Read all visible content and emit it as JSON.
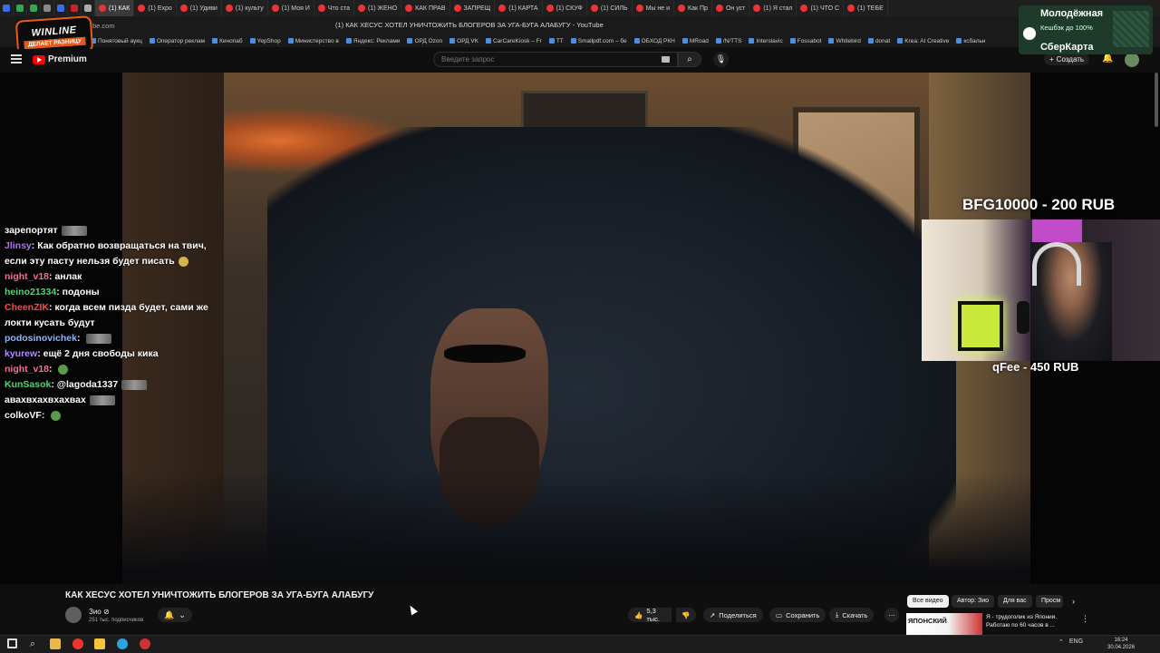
{
  "browser": {
    "tabs": [
      "(1) КАК",
      "(1) Expo",
      "(1) Удиви",
      "(1) культу",
      "(1) Моя И",
      "Что ста",
      "(1) ЖЕНО",
      "КАК ПРАВ",
      "ЗАПРЕЩ",
      "(1) КАРТА",
      "(1) СКУФ",
      "(1) СИЛЬ",
      "Мы не и",
      "Как Пр",
      "Он уст",
      "(1) Я стал",
      "(1) ЧТО С",
      "(1) ТЕБЕ"
    ],
    "url": "be.com",
    "page_title": "(1) КАК ХЕСУС ХОТЕЛ УНИЧТОЖИТЬ БЛОГЕРОВ ЗА УГА-БУГА АЛАБУГУ - YouTube",
    "bookmarks": [
      "Понятовый аукц",
      "Оператор реклам",
      "Кинопаб",
      "YepShop",
      "Министерство в",
      "Яндекс: Реклами",
      "ОРД Ozon",
      "ОРД VK",
      "CarCareKiosk – Fr",
      "TT",
      "Smallpdf.com – бе",
      "ОБХОД РКН",
      "MRoad",
      "/N/TTS",
      "Interslavic",
      "Fossabot",
      "Whitebird",
      "donat",
      "Krea: AI Creative",
      "ксбальн"
    ]
  },
  "overlay_ad": {
    "winline_title": "WINLINE",
    "winline_sub": "ДЕЛАЕТ РАЗНИЦУ",
    "bank_line1": "Молодёжная",
    "bank_line2": "Кешбэк до 100%",
    "bank_line3": "СберКарта"
  },
  "youtube": {
    "logo": "Premium",
    "search_placeholder": "Введите запрос",
    "create_label": "Создать"
  },
  "stream": {
    "chat": [
      {
        "name": "",
        "color": "#ffffff",
        "text": "зарепортят",
        "emote": "wide"
      },
      {
        "name": "Jlinsy",
        "color": "#b070ff",
        "text": "Как обратно возвращаться на твич, если эту пасту нельзя будет писать",
        "emote": "smile"
      },
      {
        "name": "night_v18",
        "color": "#ff6b9a",
        "text": "анлак",
        "emote": ""
      },
      {
        "name": "heino21334",
        "color": "#57d27a",
        "text": "подоны",
        "emote": ""
      },
      {
        "name": "CheenZIK",
        "color": "#ff4a4a",
        "text": "когда всем пизда будет, сами же локти кусать будут",
        "emote": ""
      },
      {
        "name": "podosinovichek",
        "color": "#8fb4ff",
        "text": "",
        "emote": "wide"
      },
      {
        "name": "kyurew",
        "color": "#b38cff",
        "text": "ещё 2 дня свободы кика",
        "emote": ""
      },
      {
        "name": "night_v18",
        "color": "#ff6b9a",
        "text": "",
        "emote": "green"
      },
      {
        "name": "KunSasok",
        "color": "#57d27a",
        "text": "@lagoda1337",
        "emote": "wide"
      },
      {
        "name": "",
        "color": "#ffffff",
        "text": "авахвхахвхахвах",
        "emote": "wide"
      },
      {
        "name": "colkoVF",
        "color": "#ffffff",
        "text": "",
        "emote": "green"
      }
    ],
    "donation_top": "BFG10000 - 200 RUB",
    "donation_bottom": "qFee - 450 RUB"
  },
  "video": {
    "title": "КАК ХЕСУС ХОТЕЛ УНИЧТОЖИТЬ БЛОГЕРОВ ЗА УГА-БУГА АЛАБУГУ",
    "channel": "Зио ⊘",
    "subscribers": "251 тыс. подписчиков",
    "likes": "5,3 тыс.",
    "share": "Поделиться",
    "save": "Сохранить",
    "download": "Скачать"
  },
  "sidebar": {
    "chips": [
      "Все видео",
      "Автор: Зио",
      "Для вас",
      "Просм"
    ],
    "rec_thumb_text": "ЯПОНСКИЙ",
    "rec_title": "Я - трудоголик из Японии. Работаю по 60 часов в ..."
  },
  "taskbar": {
    "lang": "ENG",
    "time": "16:24",
    "date": "30.04.2026"
  }
}
